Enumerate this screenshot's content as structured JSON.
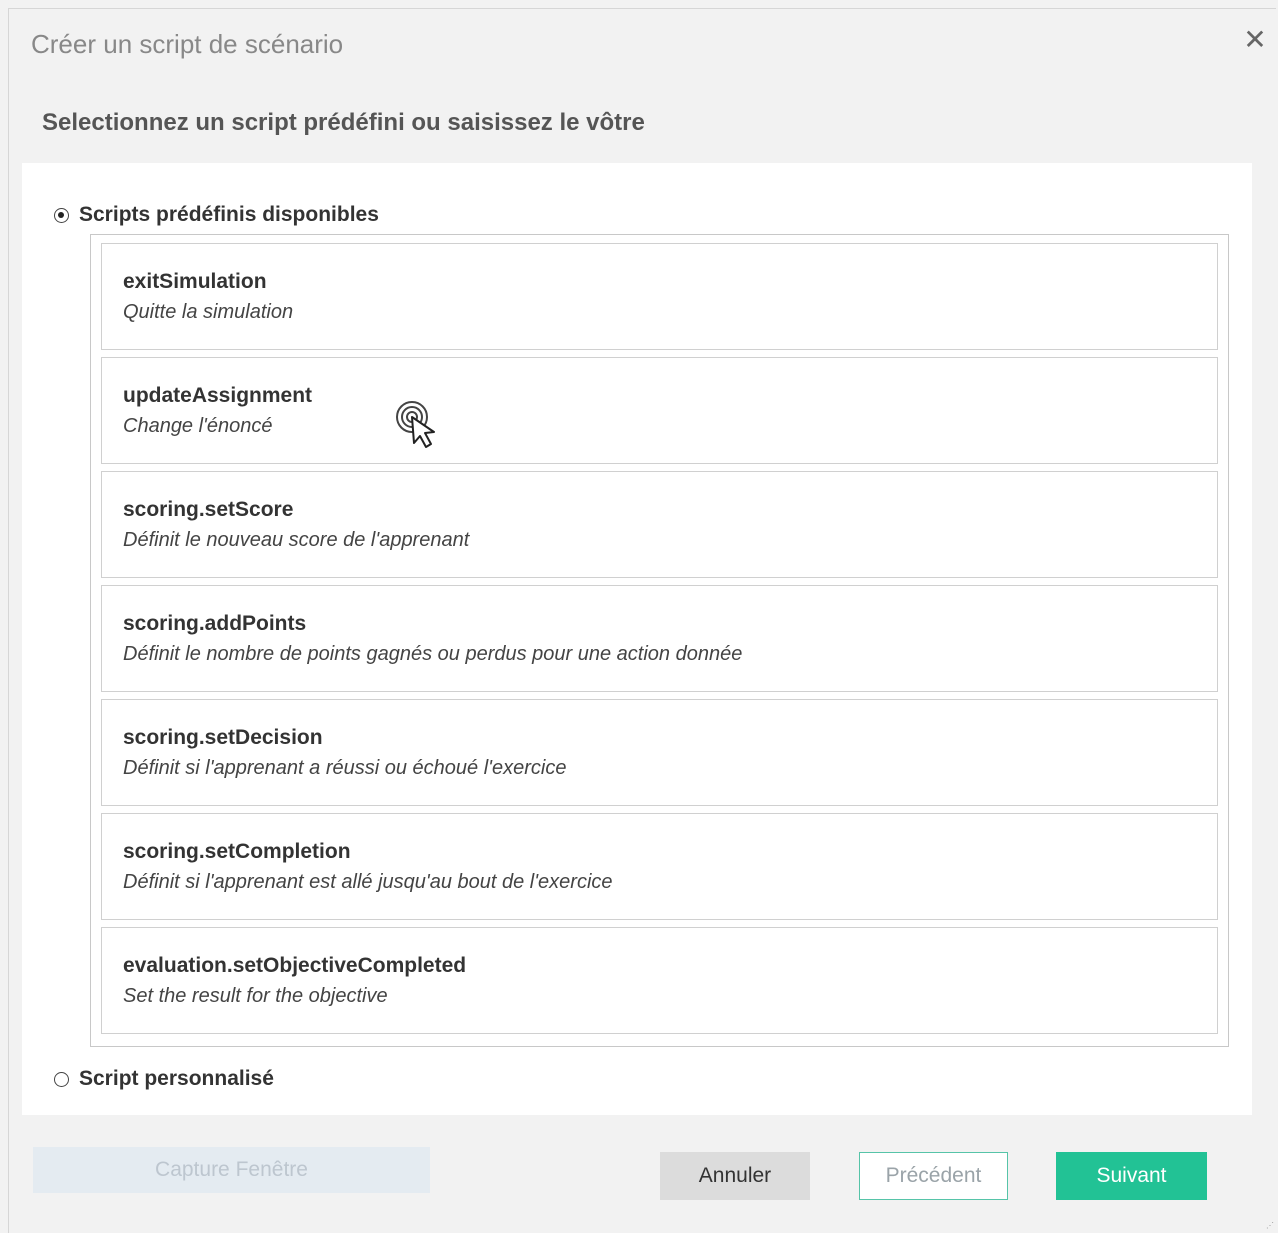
{
  "dialog": {
    "title": "Créer un script de scénario",
    "close_glyph": "✕"
  },
  "subtitle": "Selectionnez un script prédéfini ou saisissez le vôtre",
  "options": {
    "predefined_label": "Scripts prédéfinis disponibles",
    "predefined_selected": true,
    "custom_label": "Script personnalisé",
    "custom_selected": false
  },
  "scripts": [
    {
      "name": "exitSimulation",
      "description": "Quitte la simulation"
    },
    {
      "name": "updateAssignment",
      "description": "Change l'énoncé"
    },
    {
      "name": "scoring.setScore",
      "description": "Définit le nouveau score de l'apprenant"
    },
    {
      "name": "scoring.addPoints",
      "description": "Définit le nombre de points gagnés ou perdus pour une action donnée"
    },
    {
      "name": "scoring.setDecision",
      "description": "Définit si l'apprenant a réussi ou échoué l'exercice"
    },
    {
      "name": "scoring.setCompletion",
      "description": "Définit si l'apprenant est allé jusqu'au bout de l'exercice"
    },
    {
      "name": "evaluation.setObjectiveCompleted",
      "description": "Set the result for the objective"
    }
  ],
  "footer": {
    "capture_label": "Capture Fenêtre",
    "cancel_label": "Annuler",
    "previous_label": "Précédent",
    "next_label": "Suivant"
  },
  "colors": {
    "accent": "#22c295",
    "accent_border": "#56c4a8"
  },
  "icons": {
    "cursor": "hand-pointer-cursor-icon"
  }
}
